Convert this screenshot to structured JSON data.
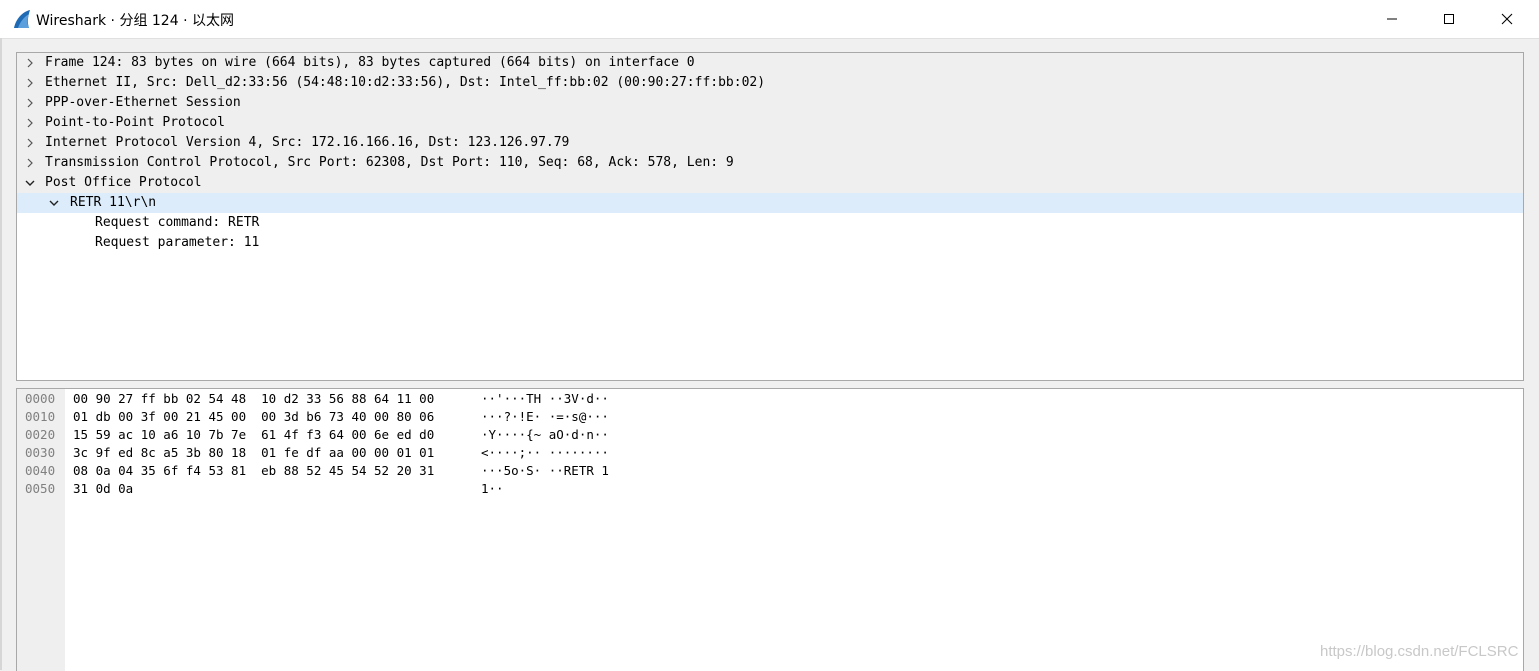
{
  "window": {
    "title": "Wireshark · 分组 124 · 以太网",
    "icon": "wireshark-fin-icon",
    "controls": [
      "minimize-icon",
      "maximize-icon",
      "close-icon"
    ]
  },
  "tree": {
    "items": [
      {
        "label": "Frame 124: 83 bytes on wire (664 bits), 83 bytes captured (664 bits) on interface 0",
        "state": "collapsed"
      },
      {
        "label": "Ethernet II, Src: Dell_d2:33:56 (54:48:10:d2:33:56), Dst: Intel_ff:bb:02 (00:90:27:ff:bb:02)",
        "state": "collapsed"
      },
      {
        "label": "PPP-over-Ethernet Session",
        "state": "collapsed"
      },
      {
        "label": "Point-to-Point Protocol",
        "state": "collapsed"
      },
      {
        "label": "Internet Protocol Version 4, Src: 172.16.166.16, Dst: 123.126.97.79",
        "state": "collapsed"
      },
      {
        "label": "Transmission Control Protocol, Src Port: 62308, Dst Port: 110, Seq: 68, Ack: 578, Len: 9",
        "state": "collapsed"
      },
      {
        "label": "Post Office Protocol",
        "state": "expanded"
      },
      {
        "label": "RETR 11\\r\\n",
        "state": "expanded",
        "selected": true
      },
      {
        "label": "Request command: RETR",
        "state": "leaf"
      },
      {
        "label": "Request parameter: 11",
        "state": "leaf"
      }
    ]
  },
  "hex": {
    "rows": [
      {
        "offset": "0000",
        "bytes": "00 90 27 ff bb 02 54 48  10 d2 33 56 88 64 11 00",
        "ascii": "··'···TH ··3V·d··"
      },
      {
        "offset": "0010",
        "bytes": "01 db 00 3f 00 21 45 00  00 3d b6 73 40 00 80 06",
        "ascii": "···?·!E· ·=·s@···"
      },
      {
        "offset": "0020",
        "bytes": "15 59 ac 10 a6 10 7b 7e  61 4f f3 64 00 6e ed d0",
        "ascii": "·Y····{~ aO·d·n··"
      },
      {
        "offset": "0030",
        "bytes": "3c 9f ed 8c a5 3b 80 18  01 fe df aa 00 00 01 01",
        "ascii": "<····;·· ········"
      },
      {
        "offset": "0040",
        "bytes": "08 0a 04 35 6f f4 53 81  eb 88 52 45 54 52 20 31",
        "ascii": "···5o·S· ··RETR 1"
      },
      {
        "offset": "0050",
        "bytes": "31 0d 0a",
        "ascii": "1··"
      }
    ]
  },
  "watermark": "https://blog.csdn.net/FCLSRC",
  "colors": {
    "selected_row": "#dcecfb",
    "collapsed_row": "#efefef",
    "offset_text": "#808080",
    "brand": "#1e6ab4"
  }
}
